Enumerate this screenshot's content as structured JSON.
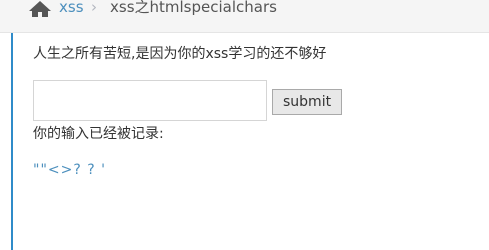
{
  "breadcrumb": {
    "home_label": "xss",
    "separator": "›",
    "current_label": "xss之htmlspecialchars"
  },
  "main": {
    "tagline": "人生之所有苦短,是因为你的xss学习的还不够好",
    "input": {
      "value": "",
      "placeholder": ""
    },
    "submit_label": "submit",
    "logged_label": "你的输入已经被记录:",
    "echo_output": "\"\"<>? ? '"
  },
  "colors": {
    "link": "#4c8fbd",
    "accent_rule": "#2f8bc9",
    "breadcrumb_bg": "#f5f5f5",
    "text": "#333333"
  },
  "icons": {
    "home": "home-icon"
  }
}
